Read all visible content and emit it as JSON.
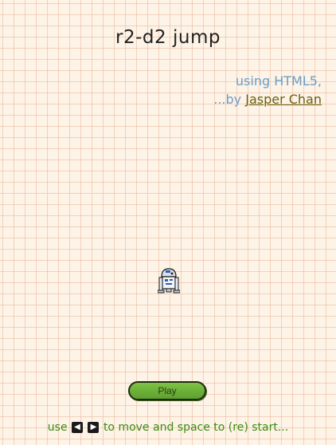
{
  "game": {
    "title": "r2-d2 jump"
  },
  "credits": {
    "line1": "using HTML5,",
    "prefix": "...by",
    "author": "Jasper Chan"
  },
  "controls": {
    "play_label": "Play",
    "use_label": "use",
    "instructions_text": "to move and space to (re) start..."
  },
  "icons": {
    "left_arrow": "left-arrow-key-icon",
    "right_arrow": "right-arrow-key-icon",
    "player": "r2d2-robot-icon"
  },
  "colors": {
    "background": "#fdf3e6",
    "grid": "#e4aa8c",
    "credits_text": "#6b9ec9",
    "author_link": "#6a6212",
    "button_fill": "#6bb03a",
    "instructions_text": "#3c8c12"
  }
}
